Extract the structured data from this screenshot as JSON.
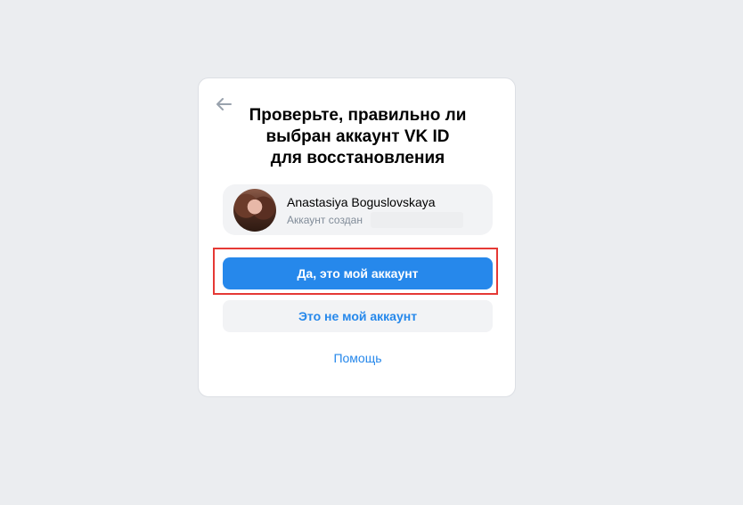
{
  "dialog": {
    "title_lines": [
      "Проверьте, правильно ли",
      "выбран аккаунт VK ID",
      "для восстановления"
    ]
  },
  "account": {
    "name": "Anastasiya Boguslovskaya",
    "created_label": "Аккаунт создан"
  },
  "actions": {
    "confirm_label": "Да, это мой аккаунт",
    "reject_label": "Это не мой аккаунт",
    "help_label": "Помощь"
  },
  "icons": {
    "back": "arrow-left-icon"
  },
  "colors": {
    "accent": "#2688eb",
    "highlight": "#e53935",
    "background": "#ebedf0"
  }
}
